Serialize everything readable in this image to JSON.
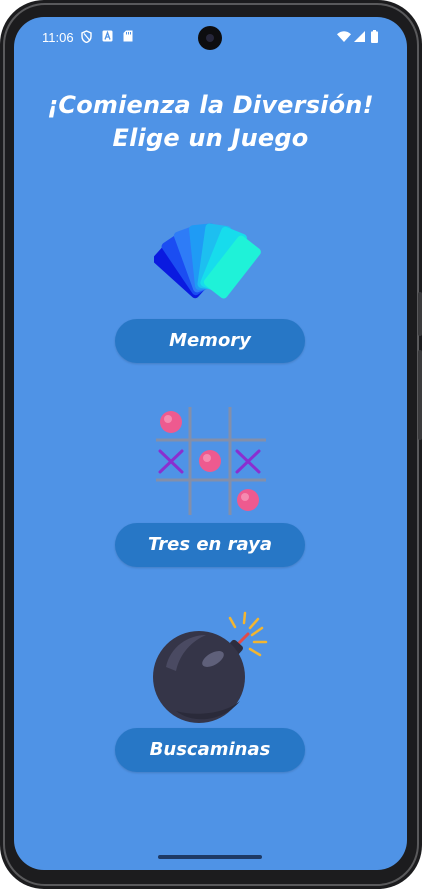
{
  "status_bar": {
    "time": "11:06",
    "left_icons": [
      "shield-icon",
      "font-a-icon",
      "sd-card-icon"
    ],
    "right_icons": [
      "wifi-icon",
      "signal-icon",
      "battery-icon"
    ]
  },
  "header": {
    "line1": "¡Comienza la Diversión!",
    "line2": "Elige un Juego"
  },
  "games": [
    {
      "label": "Memory",
      "icon": "cards-fan-icon"
    },
    {
      "label": "Tres en raya",
      "icon": "tic-tac-toe-icon"
    },
    {
      "label": "Buscaminas",
      "icon": "bomb-icon"
    }
  ],
  "colors": {
    "background": "#4f93e6",
    "button": "#2777c6",
    "text": "#ffffff"
  }
}
